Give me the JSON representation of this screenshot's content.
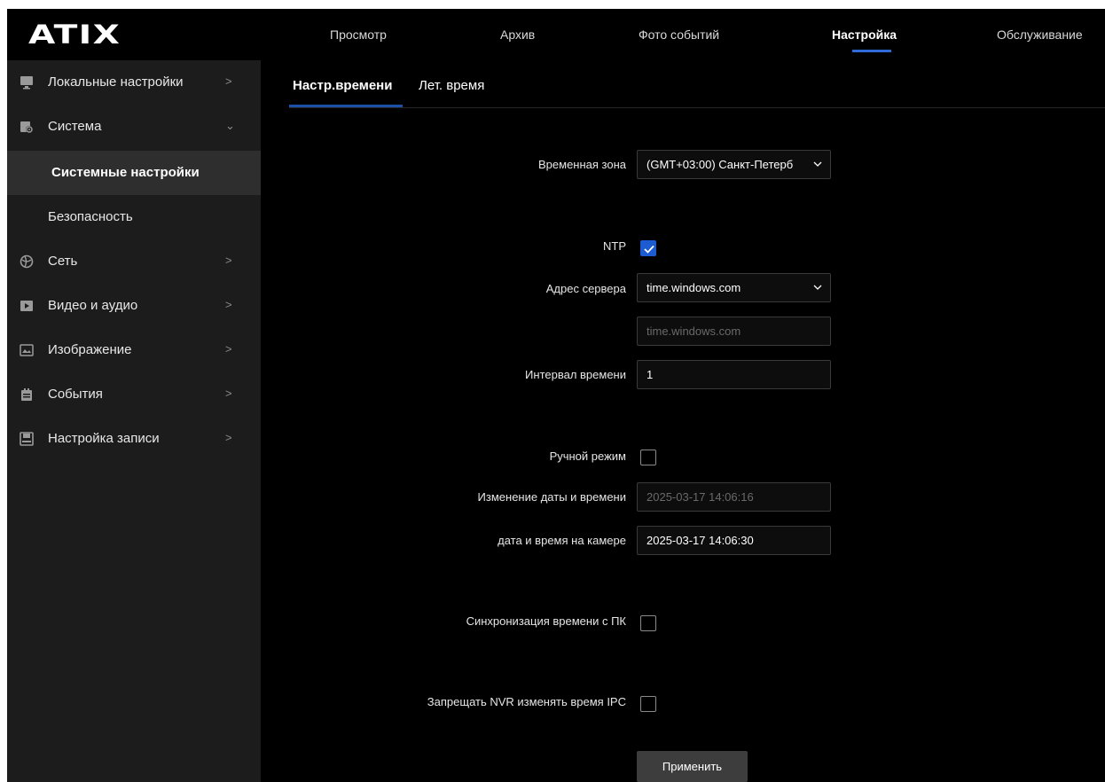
{
  "header": {
    "logo": "ATIX",
    "nav": [
      {
        "label": "Просмотр",
        "active": false
      },
      {
        "label": "Архив",
        "active": false
      },
      {
        "label": "Фото событий",
        "active": false
      },
      {
        "label": "Настройка",
        "active": true
      },
      {
        "label": "Обслуживание",
        "active": false
      }
    ]
  },
  "sidebar": {
    "items": [
      {
        "label": "Локальные настройки",
        "icon": "monitor-icon",
        "expand": ">"
      },
      {
        "label": "Система",
        "icon": "system-settings-icon",
        "expand": "⌄"
      },
      {
        "label": "Системные настройки",
        "selected": true
      },
      {
        "label": "Безопасность"
      },
      {
        "label": "Сеть",
        "icon": "network-icon",
        "expand": ">"
      },
      {
        "label": "Видео и аудио",
        "icon": "video-icon",
        "expand": ">"
      },
      {
        "label": "Изображение",
        "icon": "image-icon",
        "expand": ">"
      },
      {
        "label": "События",
        "icon": "events-icon",
        "expand": ">"
      },
      {
        "label": "Настройка записи",
        "icon": "record-settings-icon",
        "expand": ">"
      }
    ]
  },
  "tabs": [
    {
      "label": "Настр.времени",
      "active": true
    },
    {
      "label": "Лет. время",
      "active": false
    }
  ],
  "form": {
    "timezone_label": "Временная зона",
    "timezone_value": "(GMT+03:00) Санкт-Петерб",
    "ntp_label": "NTP",
    "ntp_checked": true,
    "server_label": "Адрес сервера",
    "server_value": "time.windows.com",
    "server_custom_placeholder": "time.windows.com",
    "interval_label": "Интервал времени",
    "interval_value": "1",
    "manual_label": "Ручной режим",
    "manual_checked": false,
    "change_datetime_label": "Изменение даты и времени",
    "change_datetime_value": "2025-03-17 14:06:16",
    "camera_datetime_label": "дата и время на камере",
    "camera_datetime_value": "2025-03-17 14:06:30",
    "sync_pc_label": "Синхронизация времени с ПК",
    "sync_pc_checked": false,
    "forbid_nvr_label": "Запрещать NVR изменять время IPC",
    "forbid_nvr_checked": false,
    "apply_label": "Применить"
  },
  "colors": {
    "accent": "#1d5bd1",
    "background": "#000000",
    "sidebar": "#1c1c1c"
  }
}
